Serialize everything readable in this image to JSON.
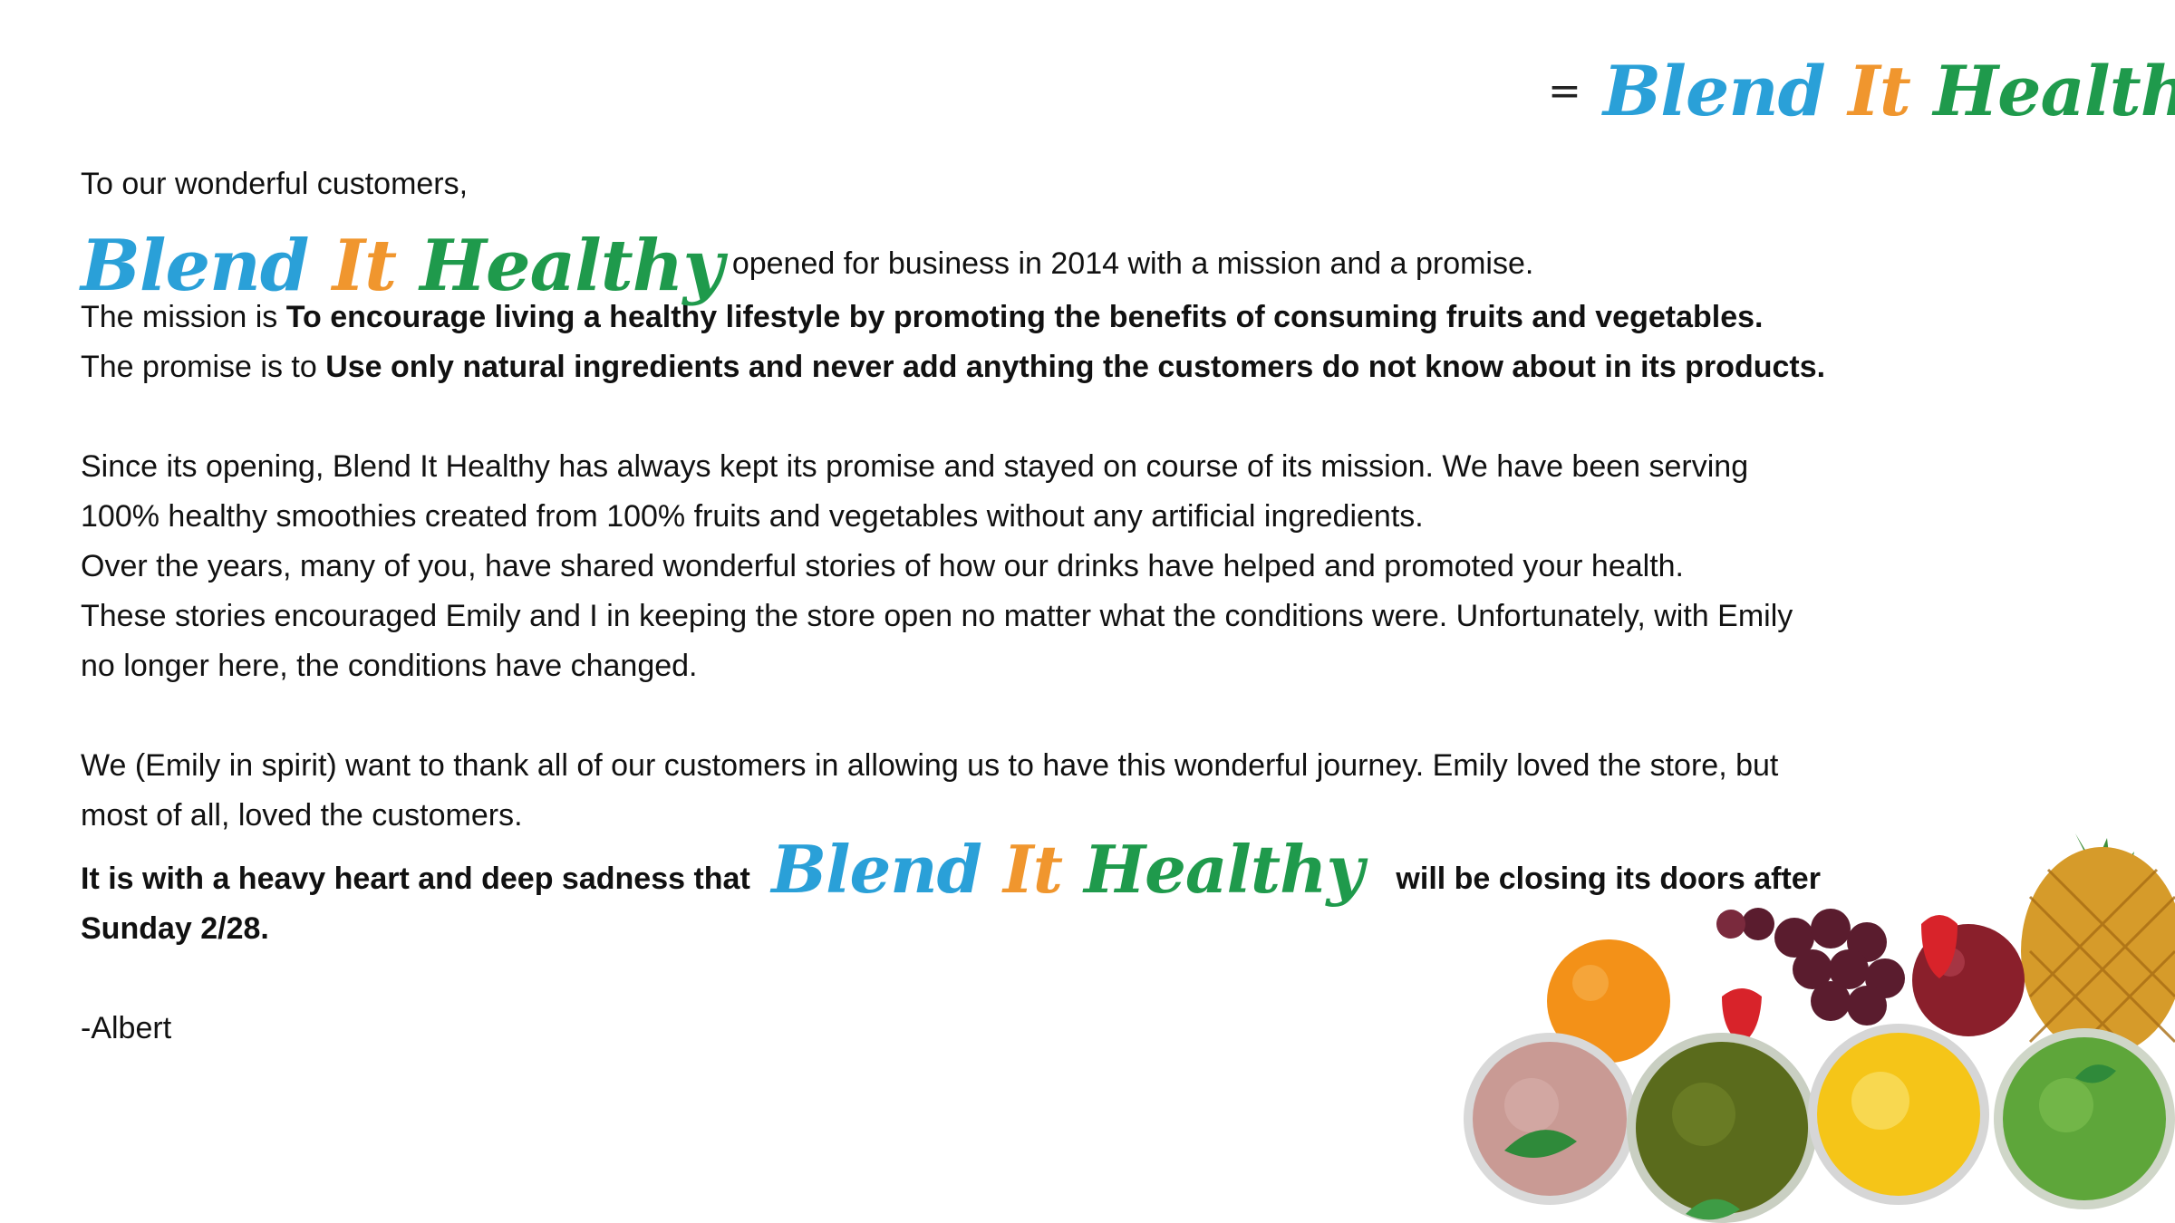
{
  "brand": {
    "word1": "Blend",
    "word2": "It",
    "word3": "Healthy",
    "colors": {
      "blue": "#2aa0d8",
      "orange": "#f0962e",
      "green": "#1f9a4c",
      "heart": "#e2202b"
    }
  },
  "logo": {
    "equals": "=",
    "icons": [
      "blender-icon",
      "heartbeat-icon"
    ]
  },
  "letter": {
    "greeting": "To our wonderful customers,",
    "opening_tail": "opened for business in 2014 with a mission and a promise.",
    "mission_intro": "The mission is ",
    "mission_text": "To encourage living a healthy lifestyle by promoting the benefits of consuming fruits and vegetables.",
    "promise_intro": "The promise is to ",
    "promise_text": "Use only natural ingredients and never add anything the customers do not know about in its products.",
    "para2": [
      "Since its opening, Blend It Healthy has always kept its promise and stayed on course of its mission. We have been serving",
      "100% healthy smoothies created from 100% fruits and vegetables without any artificial ingredients.",
      "Over the years, many of you, have shared wonderful stories of how our drinks have helped and promoted your health.",
      "These stories encouraged Emily and I in keeping the store open no matter what the conditions were. Unfortunately, with Emily",
      "no longer here, the conditions have changed."
    ],
    "para3": [
      "We (Emily in spirit) want to thank all of our customers in allowing us to have this wonderful journey. Emily loved the store, but",
      "most of all, loved the customers."
    ],
    "closing_start": "It is with a heavy heart and deep sadness that",
    "closing_end": "will be closing its doors after Sunday 2/28.",
    "signature": "-Albert"
  }
}
